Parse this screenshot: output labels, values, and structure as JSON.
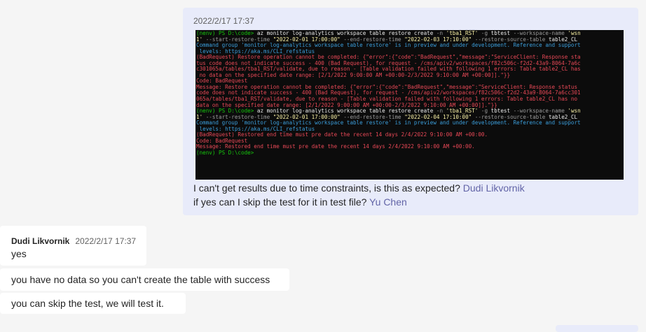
{
  "self_message": {
    "timestamp": "2022/2/17 17:37",
    "terminal_lines": [
      [
        {
          "c": "g",
          "t": "(nenv) PS D:\\code> "
        },
        {
          "c": "w",
          "t": "az monitor log-analytics workspace table restore create "
        },
        {
          "c": "d",
          "t": "-n "
        },
        {
          "c": "y",
          "t": "'tba1_RST' "
        },
        {
          "c": "d",
          "t": "-g "
        },
        {
          "c": "w",
          "t": "tbtest "
        },
        {
          "c": "d",
          "t": "--workspace-name "
        },
        {
          "c": "y",
          "t": "'wsn"
        }
      ],
      [
        {
          "c": "y",
          "t": "1' "
        },
        {
          "c": "d",
          "t": "--start-restore-time "
        },
        {
          "c": "y",
          "t": "\"2022-02-01 17:00:00\" "
        },
        {
          "c": "d",
          "t": "--end-restore-time "
        },
        {
          "c": "y",
          "t": "\"2022-02-03 17:10:00\" "
        },
        {
          "c": "d",
          "t": "--restore-source-table "
        },
        {
          "c": "w",
          "t": "table2_CL"
        }
      ],
      [
        {
          "c": "b",
          "t": "Command group 'monitor log-analytics workspace table restore' is in preview and under development. Reference and support"
        }
      ],
      [
        {
          "c": "b",
          "t": " levels: https://aka.ms/CLI_refstatus"
        }
      ],
      [
        {
          "c": "r",
          "t": "(BadRequest) Restore operation cannot be completed: {\"error\":{\"code\":\"BadRequest\",\"message\":\"ServiceClient: Response sta"
        }
      ],
      [
        {
          "c": "r",
          "t": "tus code does not indicate success - 400 (Bad Request), for request - /cms/apiv2/workspaces/f82c506c-f2d2-43a9-8064-7a6c"
        }
      ],
      [
        {
          "c": "r",
          "t": "c301065a/tables/tba1_RST/validate, due to reason - [Table validation failed with following 1 errors: Table table2_CL has"
        }
      ],
      [
        {
          "c": "r",
          "t": " no data on the specified date range: [2/1/2022 9:00:00 AM +00:00-2/3/2022 9:10:00 AM +00:00]].\"}}"
        }
      ],
      [
        {
          "c": "r",
          "t": "Code: BadRequest"
        }
      ],
      [
        {
          "c": "r",
          "t": "Message: Restore operation cannot be completed: {\"error\":{\"code\":\"BadRequest\",\"message\":\"ServiceClient: Response status"
        }
      ],
      [
        {
          "c": "r",
          "t": "code does not indicate success - 400 (Bad Request), for request - /cms/apiv2/workspaces/f82c506c-f2d2-43a9-8064-7a6cc301"
        }
      ],
      [
        {
          "c": "r",
          "t": "065a/tables/tba1_RST/validate, due to reason - [Table validation failed with following 1 errors: Table table2_CL has no"
        }
      ],
      [
        {
          "c": "r",
          "t": "data on the specified date range: [2/1/2022 9:00:00 AM +00:00-2/3/2022 9:10:00 AM +00:00]].\"}}"
        }
      ],
      [
        {
          "c": "g",
          "t": "(nenv) PS D:\\code> "
        },
        {
          "c": "w",
          "t": "az monitor log-analytics workspace table restore create "
        },
        {
          "c": "d",
          "t": "-n "
        },
        {
          "c": "y",
          "t": "'tba1_RST' "
        },
        {
          "c": "d",
          "t": "-g "
        },
        {
          "c": "w",
          "t": "tbtest "
        },
        {
          "c": "d",
          "t": "--workspace-name "
        },
        {
          "c": "y",
          "t": "'wsn"
        }
      ],
      [
        {
          "c": "y",
          "t": "1' "
        },
        {
          "c": "d",
          "t": "--start-restore-time "
        },
        {
          "c": "y",
          "t": "\"2022-02-01 17:00:00\" "
        },
        {
          "c": "d",
          "t": "--end-restore-time "
        },
        {
          "c": "y",
          "t": "\"2022-02-04 17:10:00\" "
        },
        {
          "c": "d",
          "t": "--restore-source-table "
        },
        {
          "c": "w",
          "t": "table2_CL"
        }
      ],
      [
        {
          "c": "b",
          "t": "Command group 'monitor log-analytics workspace table restore' is in preview and under development. Reference and support"
        }
      ],
      [
        {
          "c": "b",
          "t": " levels: https://aka.ms/CLI_refstatus"
        }
      ],
      [
        {
          "c": "r",
          "t": "(BadRequest) Restored end time must pre date the recent 14 days 2/4/2022 9:10:00 AM +00:00."
        }
      ],
      [
        {
          "c": "r",
          "t": "Code: BadRequest"
        }
      ],
      [
        {
          "c": "r",
          "t": "Message: Restored end time must pre date the recent 14 days 2/4/2022 9:10:00 AM +00:00."
        }
      ],
      [
        {
          "c": "g",
          "t": "(nenv) PS D:\\code>"
        }
      ]
    ],
    "line1_text": "I can't get results due to time constraints, is this as expected? ",
    "line1_mention": "Dudi Likvornik",
    "line2_text": "if yes can I skip the test for it in test file? ",
    "line2_mention": "Yu Chen"
  },
  "other_messages": {
    "sender": "Dudi Likvornik",
    "timestamp": "2022/2/17 17:37",
    "msg1": "yes",
    "msg2": "you have no data so you can't create the table with success",
    "msg3": "you can skip the test, we will test it."
  },
  "colors": {
    "self_bubble": "#e8ebfa",
    "other_bubble": "#ffffff",
    "mention": "#6264a7",
    "background": "#f5f5f5"
  }
}
